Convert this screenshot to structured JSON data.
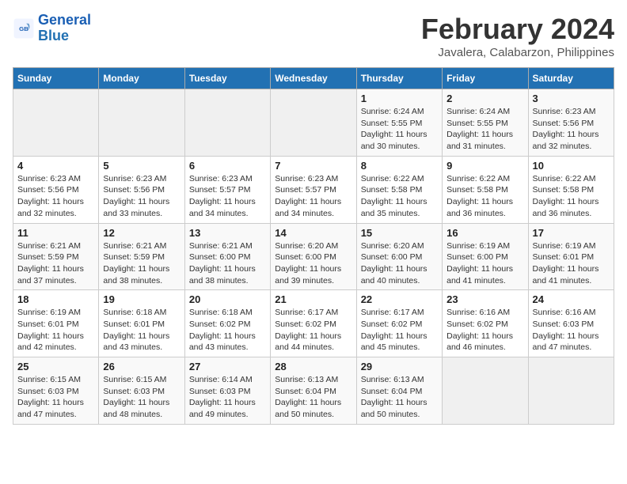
{
  "header": {
    "logo_line1": "General",
    "logo_line2": "Blue",
    "title": "February 2024",
    "subtitle": "Javalera, Calabarzon, Philippines"
  },
  "weekdays": [
    "Sunday",
    "Monday",
    "Tuesday",
    "Wednesday",
    "Thursday",
    "Friday",
    "Saturday"
  ],
  "weeks": [
    [
      {
        "day": "",
        "info": ""
      },
      {
        "day": "",
        "info": ""
      },
      {
        "day": "",
        "info": ""
      },
      {
        "day": "",
        "info": ""
      },
      {
        "day": "1",
        "info": "Sunrise: 6:24 AM\nSunset: 5:55 PM\nDaylight: 11 hours\nand 30 minutes."
      },
      {
        "day": "2",
        "info": "Sunrise: 6:24 AM\nSunset: 5:55 PM\nDaylight: 11 hours\nand 31 minutes."
      },
      {
        "day": "3",
        "info": "Sunrise: 6:23 AM\nSunset: 5:56 PM\nDaylight: 11 hours\nand 32 minutes."
      }
    ],
    [
      {
        "day": "4",
        "info": "Sunrise: 6:23 AM\nSunset: 5:56 PM\nDaylight: 11 hours\nand 32 minutes."
      },
      {
        "day": "5",
        "info": "Sunrise: 6:23 AM\nSunset: 5:56 PM\nDaylight: 11 hours\nand 33 minutes."
      },
      {
        "day": "6",
        "info": "Sunrise: 6:23 AM\nSunset: 5:57 PM\nDaylight: 11 hours\nand 34 minutes."
      },
      {
        "day": "7",
        "info": "Sunrise: 6:23 AM\nSunset: 5:57 PM\nDaylight: 11 hours\nand 34 minutes."
      },
      {
        "day": "8",
        "info": "Sunrise: 6:22 AM\nSunset: 5:58 PM\nDaylight: 11 hours\nand 35 minutes."
      },
      {
        "day": "9",
        "info": "Sunrise: 6:22 AM\nSunset: 5:58 PM\nDaylight: 11 hours\nand 36 minutes."
      },
      {
        "day": "10",
        "info": "Sunrise: 6:22 AM\nSunset: 5:58 PM\nDaylight: 11 hours\nand 36 minutes."
      }
    ],
    [
      {
        "day": "11",
        "info": "Sunrise: 6:21 AM\nSunset: 5:59 PM\nDaylight: 11 hours\nand 37 minutes."
      },
      {
        "day": "12",
        "info": "Sunrise: 6:21 AM\nSunset: 5:59 PM\nDaylight: 11 hours\nand 38 minutes."
      },
      {
        "day": "13",
        "info": "Sunrise: 6:21 AM\nSunset: 6:00 PM\nDaylight: 11 hours\nand 38 minutes."
      },
      {
        "day": "14",
        "info": "Sunrise: 6:20 AM\nSunset: 6:00 PM\nDaylight: 11 hours\nand 39 minutes."
      },
      {
        "day": "15",
        "info": "Sunrise: 6:20 AM\nSunset: 6:00 PM\nDaylight: 11 hours\nand 40 minutes."
      },
      {
        "day": "16",
        "info": "Sunrise: 6:19 AM\nSunset: 6:00 PM\nDaylight: 11 hours\nand 41 minutes."
      },
      {
        "day": "17",
        "info": "Sunrise: 6:19 AM\nSunset: 6:01 PM\nDaylight: 11 hours\nand 41 minutes."
      }
    ],
    [
      {
        "day": "18",
        "info": "Sunrise: 6:19 AM\nSunset: 6:01 PM\nDaylight: 11 hours\nand 42 minutes."
      },
      {
        "day": "19",
        "info": "Sunrise: 6:18 AM\nSunset: 6:01 PM\nDaylight: 11 hours\nand 43 minutes."
      },
      {
        "day": "20",
        "info": "Sunrise: 6:18 AM\nSunset: 6:02 PM\nDaylight: 11 hours\nand 43 minutes."
      },
      {
        "day": "21",
        "info": "Sunrise: 6:17 AM\nSunset: 6:02 PM\nDaylight: 11 hours\nand 44 minutes."
      },
      {
        "day": "22",
        "info": "Sunrise: 6:17 AM\nSunset: 6:02 PM\nDaylight: 11 hours\nand 45 minutes."
      },
      {
        "day": "23",
        "info": "Sunrise: 6:16 AM\nSunset: 6:02 PM\nDaylight: 11 hours\nand 46 minutes."
      },
      {
        "day": "24",
        "info": "Sunrise: 6:16 AM\nSunset: 6:03 PM\nDaylight: 11 hours\nand 47 minutes."
      }
    ],
    [
      {
        "day": "25",
        "info": "Sunrise: 6:15 AM\nSunset: 6:03 PM\nDaylight: 11 hours\nand 47 minutes."
      },
      {
        "day": "26",
        "info": "Sunrise: 6:15 AM\nSunset: 6:03 PM\nDaylight: 11 hours\nand 48 minutes."
      },
      {
        "day": "27",
        "info": "Sunrise: 6:14 AM\nSunset: 6:03 PM\nDaylight: 11 hours\nand 49 minutes."
      },
      {
        "day": "28",
        "info": "Sunrise: 6:13 AM\nSunset: 6:04 PM\nDaylight: 11 hours\nand 50 minutes."
      },
      {
        "day": "29",
        "info": "Sunrise: 6:13 AM\nSunset: 6:04 PM\nDaylight: 11 hours\nand 50 minutes."
      },
      {
        "day": "",
        "info": ""
      },
      {
        "day": "",
        "info": ""
      }
    ]
  ]
}
